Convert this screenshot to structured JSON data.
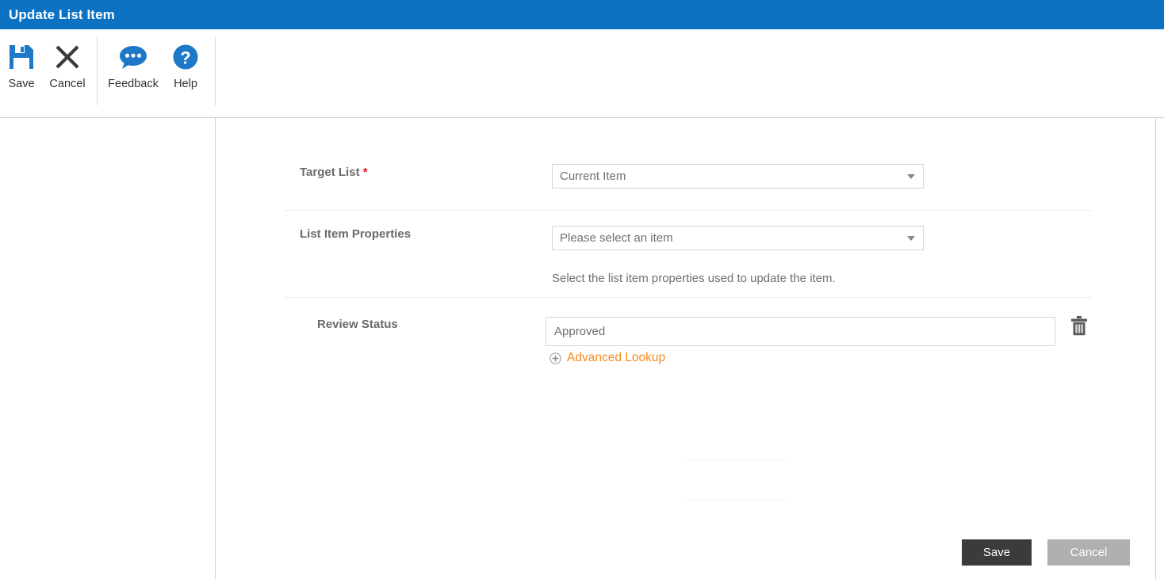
{
  "window": {
    "title": "Update List Item"
  },
  "toolbar": {
    "buttons": [
      {
        "label": "Save",
        "icon": "save-floppy-icon"
      },
      {
        "label": "Cancel",
        "icon": "close-x-icon"
      },
      {
        "label": "Feedback",
        "icon": "speech-bubble-icon"
      },
      {
        "label": "Help",
        "icon": "question-circle-icon"
      }
    ]
  },
  "form": {
    "rows": [
      {
        "label": "Target List",
        "required": true,
        "required_marker": "*",
        "control": "dropdown",
        "value": "Current Item"
      },
      {
        "label": "List Item Properties",
        "required": false,
        "control": "dropdown",
        "value": "Please select an item",
        "helper": "Select the list item properties used to update the item."
      },
      {
        "label": "Review Status",
        "required": false,
        "control": "textfield",
        "value": "Approved",
        "lookup_label": "Advanced Lookup",
        "lookup_icon": "plus-circle-icon",
        "delete_icon": "trash-icon"
      }
    ]
  },
  "footer": {
    "save_label": "Save",
    "cancel_label": "Cancel"
  },
  "colors": {
    "titlebar_blue": "#0b72c4",
    "icon_blue": "#1e78c8",
    "required_red": "#e8122a",
    "link_orange": "#f6891f",
    "save_button": "#3b3b3b",
    "cancel_button": "#b0b0b0"
  }
}
